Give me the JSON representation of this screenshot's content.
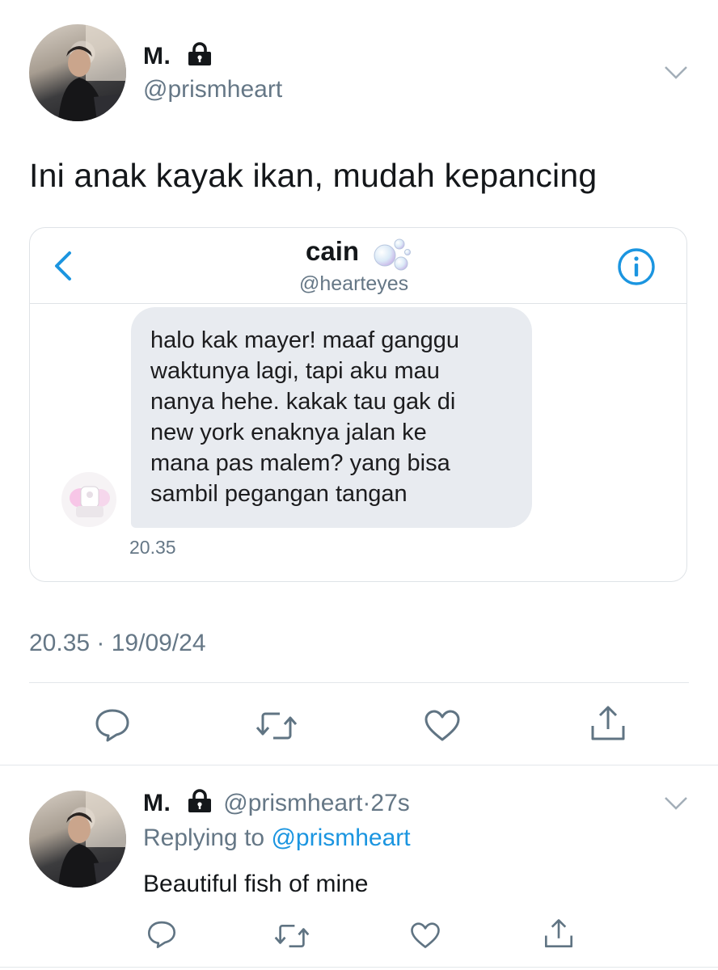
{
  "tweet": {
    "author_name": "M.",
    "author_handle": "@prismheart",
    "text": "Ini anak kayak ikan, mudah kepancing",
    "timestamp": "20.35 · 19/09/24",
    "locked": true
  },
  "dm_card": {
    "contact_name": "cain",
    "contact_handle": "@hearteyes",
    "message": "halo kak mayer! maaf ganggu\nwaktunya lagi, tapi aku mau\nnanya hehe. kakak tau gak di\nnew york enaknya jalan ke\nmana pas malem? yang bisa\nsambil pegangan tangan",
    "message_time": "20.35",
    "icons": [
      "back-chevron-icon",
      "info-icon",
      "bubbles-emoji-icon"
    ]
  },
  "actions": [
    "reply-icon",
    "retweet-icon",
    "like-icon",
    "share-icon"
  ],
  "reply": {
    "author_name": "M.",
    "author_handle": "@prismheart",
    "age": "27s",
    "replying_prefix": "Replying to",
    "replying_to": "@prismheart",
    "text": "Beautiful fish of mine"
  },
  "colors": {
    "accent": "#1b95e0",
    "muted": "#657786",
    "bubble": "#e8ebf0",
    "border": "#dfe3e7"
  }
}
